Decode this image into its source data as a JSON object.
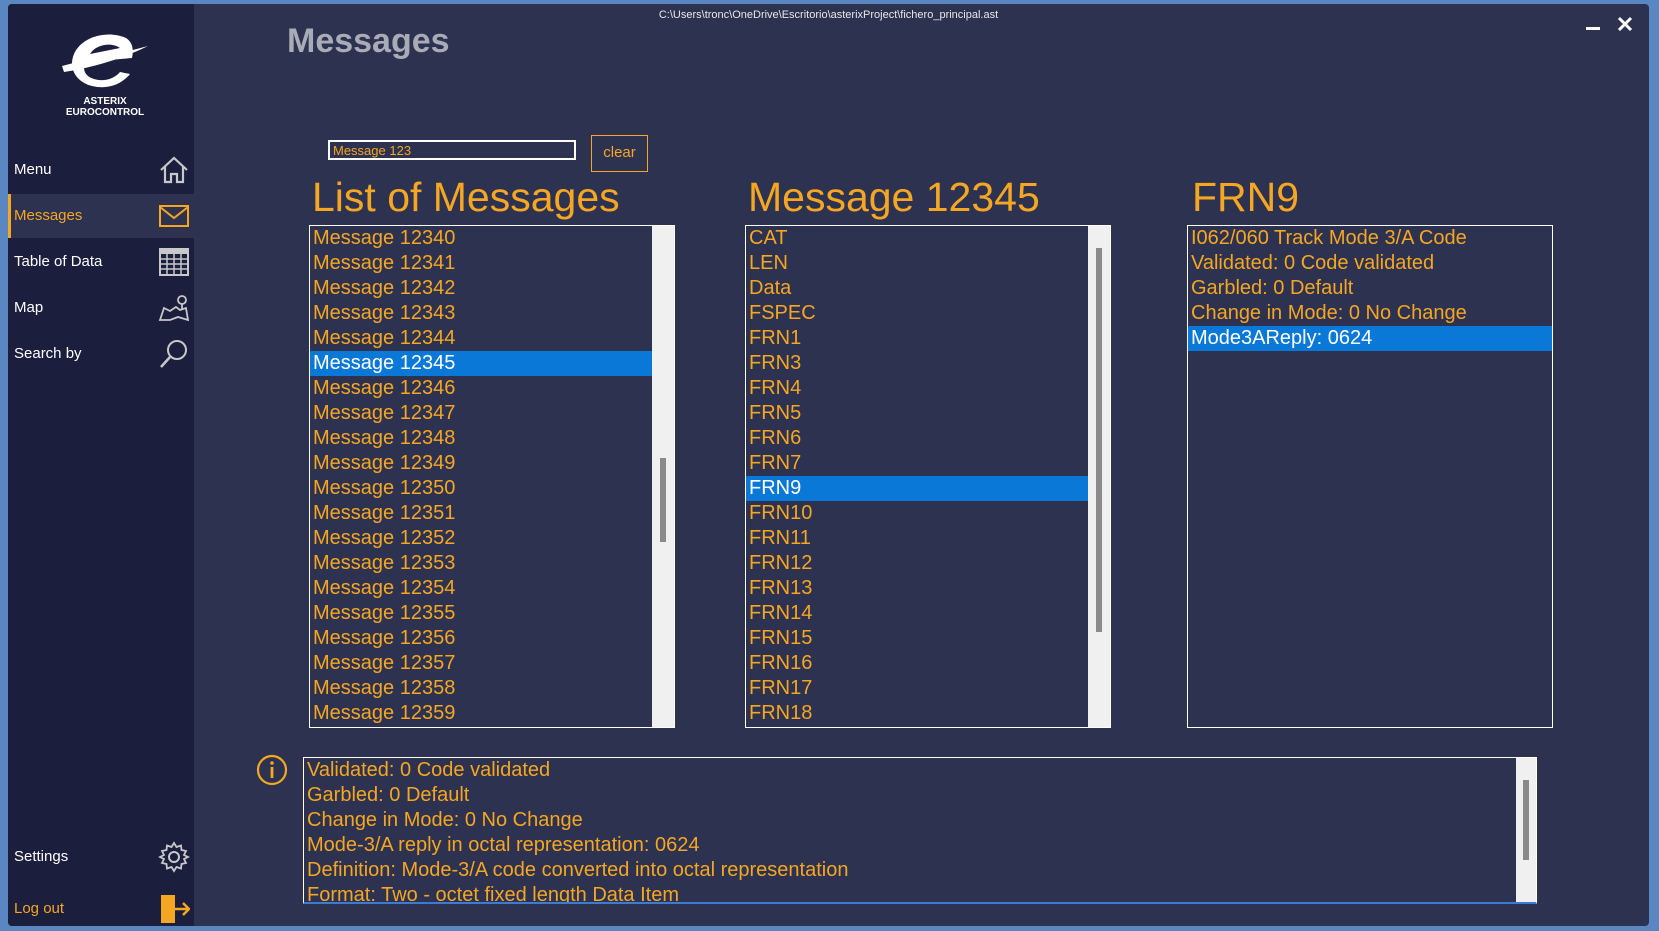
{
  "window": {
    "path": "C:\\Users\\tronc\\OneDrive\\Escritorio\\asterixProject\\fichero_principal.ast",
    "title": "Messages"
  },
  "logo": {
    "line1": "ASTERIX",
    "line2": "EUROCONTROL"
  },
  "nav": {
    "menu": "Menu",
    "messages": "Messages",
    "table": "Table of Data",
    "map": "Map",
    "search": "Search by",
    "settings": "Settings",
    "logout": "Log out"
  },
  "search": {
    "value": "Message 123",
    "clear_label": "clear"
  },
  "colors": {
    "accent": "#f5a623",
    "selection": "#0a78d7",
    "background": "#2d3250",
    "sidebar": "#1b1e3c"
  },
  "panels": {
    "messages": {
      "header": "List of Messages",
      "items": [
        "Message 12340",
        "Message 12341",
        "Message 12342",
        "Message 12343",
        "Message 12344",
        "Message 12345",
        "Message 12346",
        "Message 12347",
        "Message 12348",
        "Message 12349",
        "Message 12350",
        "Message 12351",
        "Message 12352",
        "Message 12353",
        "Message 12354",
        "Message 12355",
        "Message 12356",
        "Message 12357",
        "Message 12358",
        "Message 12359"
      ],
      "selected": "Message 12345"
    },
    "fields": {
      "header": "Message 12345",
      "items": [
        "CAT",
        "LEN",
        "Data",
        "FSPEC",
        "FRN1",
        "FRN3",
        "FRN4",
        "FRN5",
        "FRN6",
        "FRN7",
        "FRN9",
        "FRN10",
        "FRN11",
        "FRN12",
        "FRN13",
        "FRN14",
        "FRN15",
        "FRN16",
        "FRN17",
        "FRN18"
      ],
      "selected": "FRN9"
    },
    "values": {
      "header": "FRN9",
      "items": [
        "I062/060 Track Mode 3/A Code",
        "Validated: 0 Code validated",
        "Garbled: 0 Default",
        "Change in Mode: 0 No Change",
        "Mode3AReply: 0624"
      ],
      "selected": "Mode3AReply: 0624"
    }
  },
  "details": {
    "lines": [
      "Validated: 0 Code validated",
      "Garbled: 0 Default",
      "Change in Mode: 0 No Change",
      "Mode-3/A reply in octal representation: 0624",
      "Definition: Mode-3/A code converted into octal representation",
      "Format: Two - octet fixed length Data Item"
    ]
  }
}
